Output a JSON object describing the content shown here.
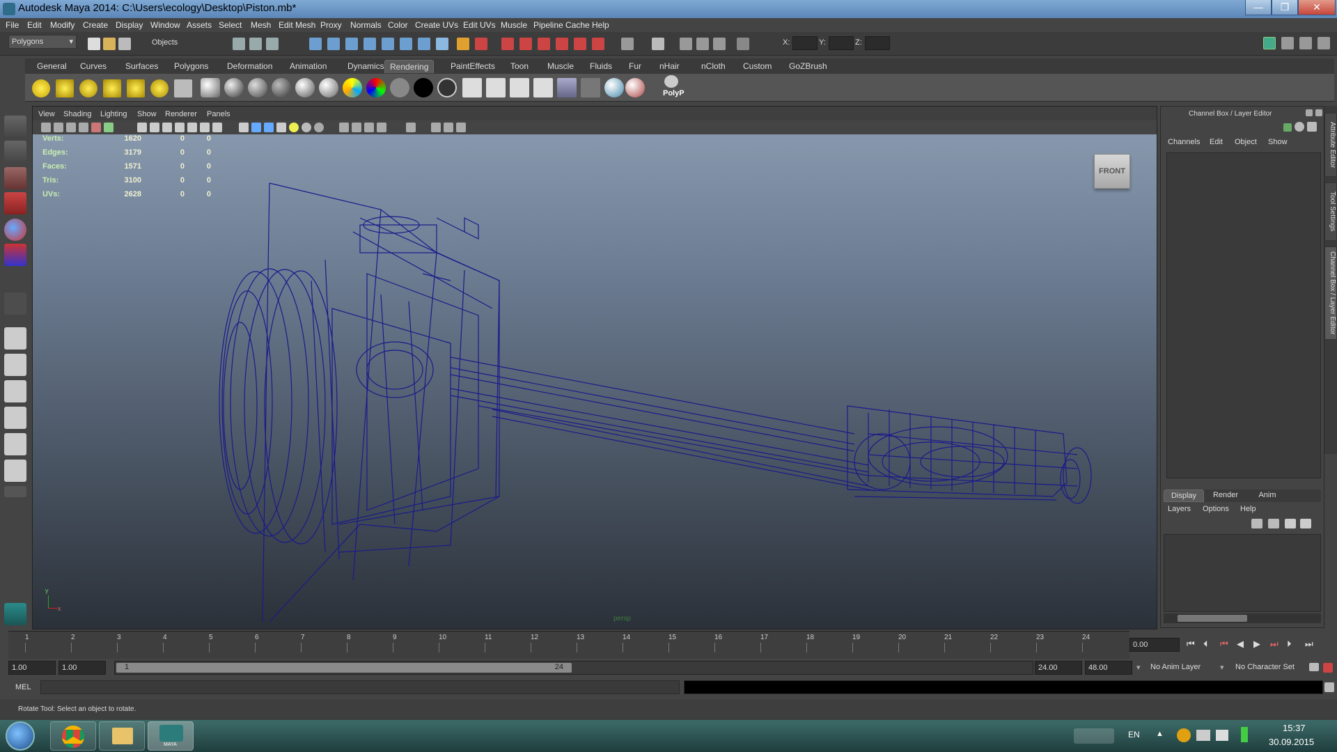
{
  "window": {
    "title": "Autodesk Maya 2014: C:\\Users\\ecology\\Desktop\\Piston.mb*",
    "buttons": [
      "—",
      "❒",
      "✕"
    ]
  },
  "menubar": {
    "items": [
      "File",
      "Edit",
      "Modify",
      "Create",
      "Display",
      "Window",
      "Assets",
      "Select",
      "Mesh",
      "Edit Mesh",
      "Proxy",
      "Normals",
      "Color",
      "Create UVs",
      "Edit UVs",
      "Muscle",
      "Pipeline Cache",
      "Help"
    ]
  },
  "statusline": {
    "menuset": "Polygons",
    "selection_mode": "Objects",
    "x_label": "X:",
    "y_label": "Y:",
    "z_label": "Z:"
  },
  "shelf": {
    "tabs": [
      "General",
      "Curves",
      "Surfaces",
      "Polygons",
      "Deformation",
      "Animation",
      "Dynamics",
      "Rendering",
      "PaintEffects",
      "Toon",
      "Muscle",
      "Fluids",
      "Fur",
      "nHair",
      "nCloth",
      "Custom",
      "GoZBrush"
    ],
    "active_tab": "Rendering",
    "polyp_label": "PolyP"
  },
  "viewport": {
    "menus": [
      "View",
      "Shading",
      "Lighting",
      "Show",
      "Renderer",
      "Panels"
    ],
    "hud": [
      {
        "label": "Verts:",
        "v1": "1620",
        "v2": "0",
        "v3": "0"
      },
      {
        "label": "Edges:",
        "v1": "3179",
        "v2": "0",
        "v3": "0"
      },
      {
        "label": "Faces:",
        "v1": "1571",
        "v2": "0",
        "v3": "0"
      },
      {
        "label": "Tris:",
        "v1": "3100",
        "v2": "0",
        "v3": "0"
      },
      {
        "label": "UVs:",
        "v1": "2628",
        "v2": "0",
        "v3": "0"
      }
    ],
    "viewcube_label": "FRONT",
    "camera_name": "persp",
    "axis_y": "y",
    "axis_x": "x",
    "wire_color": "#1a1a8a"
  },
  "channelbox": {
    "title": "Channel Box / Layer Editor",
    "menus": [
      "Channels",
      "Edit",
      "Object",
      "Show"
    ],
    "layer_tabs": [
      "Display",
      "Render",
      "Anim"
    ],
    "layer_menus": [
      "Layers",
      "Options",
      "Help"
    ]
  },
  "side_tabs": [
    "Attribute Editor",
    "Tool Settings",
    "Channel Box / Layer Editor"
  ],
  "timeslider": {
    "ticks": [
      "1",
      "2",
      "3",
      "4",
      "5",
      "6",
      "7",
      "8",
      "9",
      "10",
      "11",
      "12",
      "13",
      "14",
      "15",
      "16",
      "17",
      "18",
      "19",
      "20",
      "21",
      "22",
      "23",
      "24"
    ],
    "current_time": "0.00"
  },
  "rangeslider": {
    "start": "1.00",
    "playback_start": "1.00",
    "range_start_label": "1",
    "range_end_label": "24",
    "playback_end": "24.00",
    "end": "48.00",
    "anim_layer": "No Anim Layer",
    "character_set": "No Character Set"
  },
  "cmdline": {
    "label": "MEL"
  },
  "helpline": {
    "text": "Rotate Tool: Select an object to rotate."
  },
  "taskbar": {
    "maya_label": "MAYA",
    "lang": "EN",
    "time": "15:37",
    "date": "30.09.2015"
  }
}
